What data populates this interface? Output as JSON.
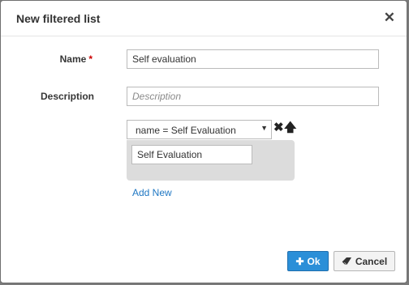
{
  "dialog": {
    "title": "New filtered list",
    "close_icon": "close-icon"
  },
  "form": {
    "name_label": "Name",
    "required_mark": "*",
    "name_value": "Self evaluation",
    "description_label": "Description",
    "description_placeholder": "Description",
    "description_value": ""
  },
  "filter": {
    "selected": "name = Self Evaluation",
    "value": "Self Evaluation",
    "remove_icon": "times-icon",
    "move_up_icon": "arrow-up-icon",
    "add_new_label": "Add New"
  },
  "footer": {
    "ok_label": "Ok",
    "ok_icon": "plus-icon",
    "cancel_label": "Cancel",
    "cancel_icon": "eraser-icon",
    "ok_color": "#2b8fd8"
  }
}
